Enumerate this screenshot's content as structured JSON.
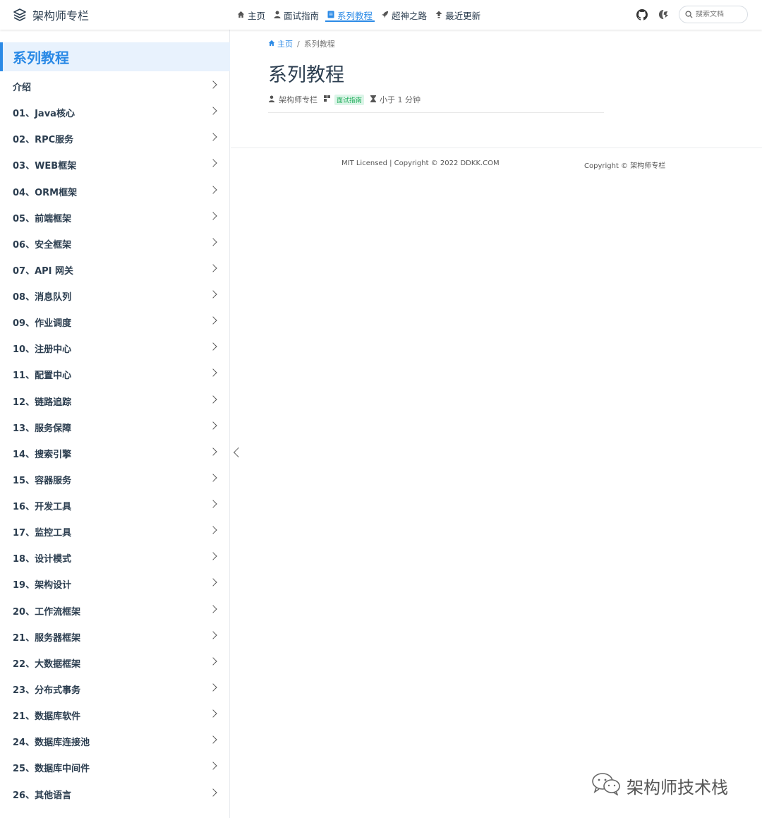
{
  "header": {
    "brand_title": "架构师专栏",
    "nav": [
      {
        "label": "主页",
        "icon": "home-icon",
        "active": false
      },
      {
        "label": "面试指南",
        "icon": "person-icon",
        "active": false
      },
      {
        "label": "系列教程",
        "icon": "book-icon",
        "active": true
      },
      {
        "label": "超神之路",
        "icon": "rocket-icon",
        "active": false
      },
      {
        "label": "最近更新",
        "icon": "upload-icon",
        "active": false
      }
    ],
    "search_placeholder": "搜索文档",
    "accent_color": "#2b8ae6"
  },
  "sidebar": {
    "heading": "系列教程",
    "items": [
      "介绍",
      "01、Java核心",
      "02、RPC服务",
      "03、WEB框架",
      "04、ORM框架",
      "05、前端框架",
      "06、安全框架",
      "07、API 网关",
      "08、消息队列",
      "09、作业调度",
      "10、注册中心",
      "11、配置中心",
      "12、链路追踪",
      "13、服务保障",
      "14、搜索引擎",
      "15、容器服务",
      "16、开发工具",
      "17、监控工具",
      "18、设计模式",
      "19、架构设计",
      "20、工作流框架",
      "21、服务器框架",
      "22、大数据框架",
      "23、分布式事务",
      "21、数据库软件",
      "24、数据库连接池",
      "25、数据库中间件",
      "26、其他语言"
    ]
  },
  "main": {
    "breadcrumb": {
      "home": "主页",
      "separator": "/",
      "current": "系列教程"
    },
    "title": "系列教程",
    "meta": {
      "author": "架构师专栏",
      "category": "面试指南",
      "reading_time": "小于 1 分钟"
    }
  },
  "footer": {
    "left": "MIT Licensed | Copyright © 2022 DDKK.COM",
    "right": "Copyright © 架构师专栏"
  },
  "watermark": "架构师技术栈"
}
